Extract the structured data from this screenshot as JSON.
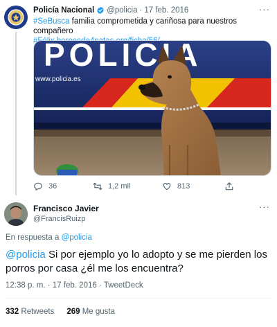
{
  "tweet": {
    "author_name": "Policía Nacional",
    "handle": "@policia",
    "separator": "·",
    "date": "17 feb. 2016",
    "more": "···",
    "hashtag": "#SeBusca",
    "text_main": "familia comprometida y cariñosa para nuestros compañero",
    "text_line2_hashtag": "#Félix",
    "link": "heroesde4patas.org/ficha/56/",
    "image": {
      "van_lettering": "POLICIA",
      "van_website": "www.policia.es"
    },
    "replies_count": "36",
    "retweets_count": "1,2 mil",
    "likes_count": "813"
  },
  "reply": {
    "author_name": "Francisco Javier",
    "handle": "@FrancisRuizp",
    "more": "···",
    "replying_prefix": "En respuesta a",
    "replying_to": "@policia",
    "mention": "@policia",
    "text": "Si por ejemplo yo lo adopto y se me pierden los porros por casa ¿él me los encuentra?",
    "time": "12:38 p. m.",
    "separator": "·",
    "date": "17 feb. 2016",
    "separator2": "·",
    "client": "TweetDeck",
    "retweets_count": "332",
    "retweets_label": "Retweets",
    "likes_count": "269",
    "likes_label": "Me gusta"
  },
  "colors": {
    "link": "#1d9bf0",
    "verified": "#1d9bf0",
    "muted": "#536471",
    "van_blue": "#1c2f70",
    "stripe_red": "#d7261e",
    "stripe_yellow": "#f2c200"
  },
  "icons": [
    "verified-badge-icon",
    "more-icon",
    "reply-icon",
    "retweet-icon",
    "like-icon",
    "share-icon"
  ]
}
